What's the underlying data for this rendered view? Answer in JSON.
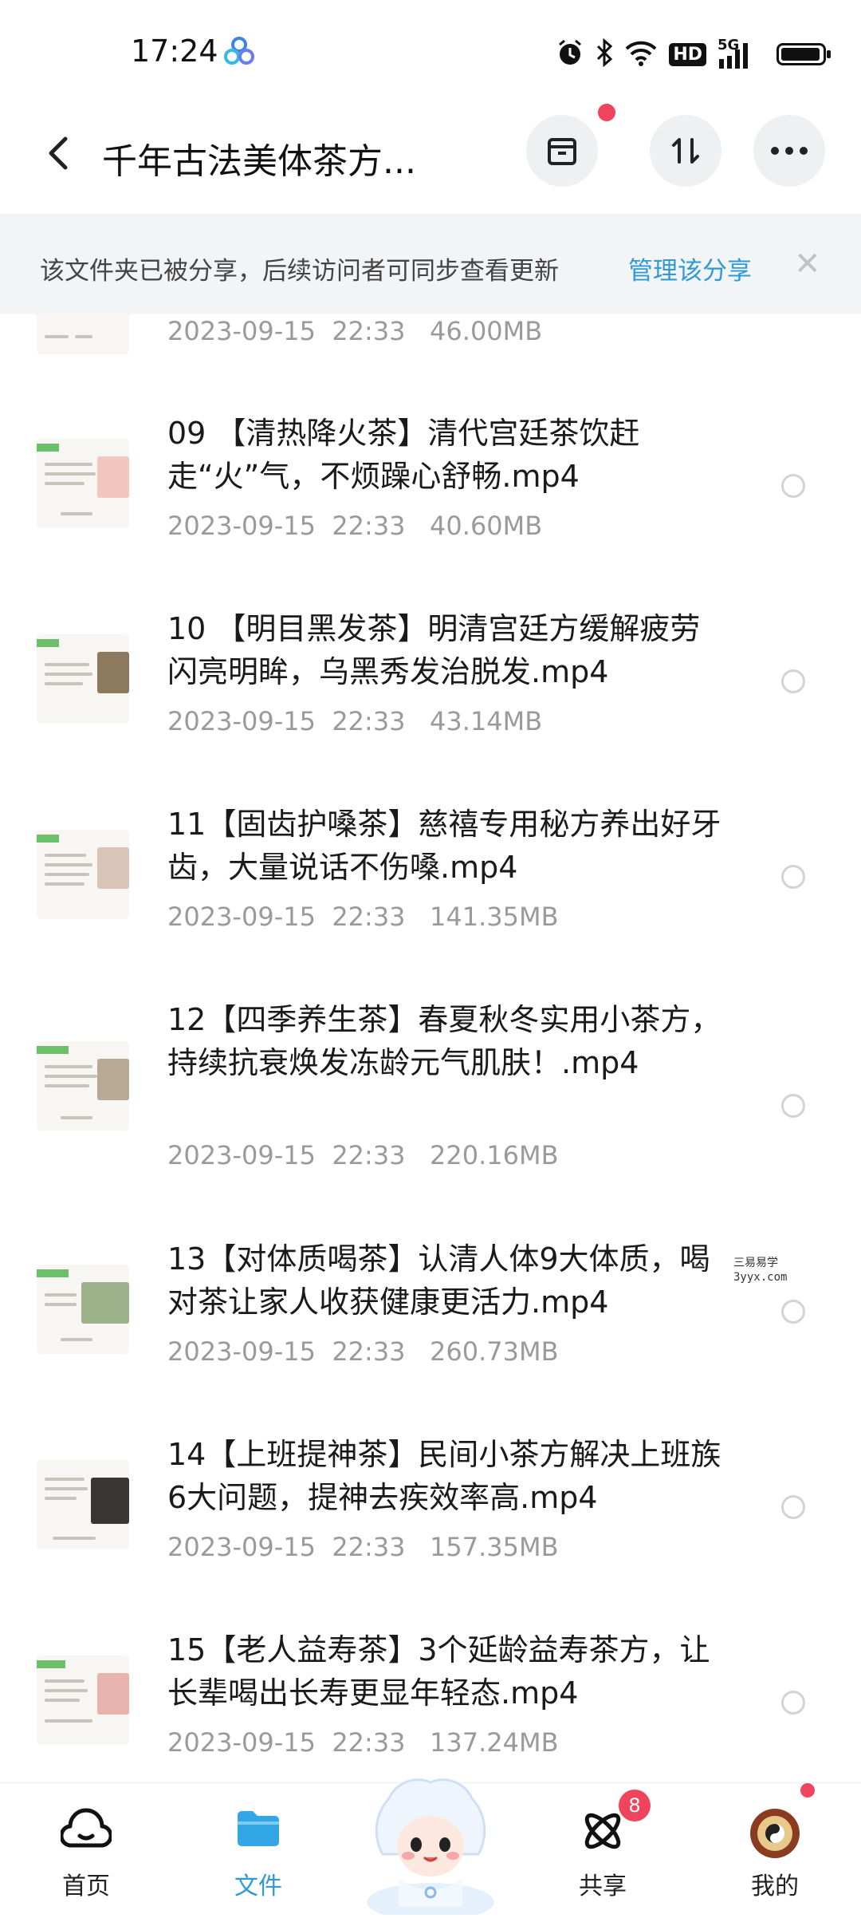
{
  "status_bar": {
    "time": "17:24",
    "icons": [
      "baidu-netdisk-icon",
      "alarm-icon",
      "bluetooth-icon",
      "wifi-icon",
      "hd-icon",
      "5g-signal-icon",
      "battery-icon"
    ],
    "hd_label": "HD",
    "network_label": "5G",
    "battery_level": 0.95
  },
  "header": {
    "title": "千年古法美体茶方...",
    "back_icon": "chevron-left-icon",
    "actions": [
      "archive-icon",
      "sort-icon",
      "more-icon"
    ]
  },
  "share_banner": {
    "text": "该文件夹已被分享，后续访问者可同步查看更新",
    "link": "管理该分享",
    "close": "✕"
  },
  "files": [
    {
      "name": "",
      "meta": "2023-09-15  22:33   46.00MB"
    },
    {
      "name": "09 【清热降火茶】清代宫廷茶饮赶走“火”气，不烦躁心舒畅.mp4",
      "meta": "2023-09-15  22:33   40.60MB"
    },
    {
      "name": "10 【明目黑发茶】明清宫廷方缓解疲劳闪亮明眸，乌黑秀发治脱发.mp4",
      "meta": "2023-09-15  22:33   43.14MB"
    },
    {
      "name": "11【固齿护嗓茶】慈禧专用秘方养出好牙齿，大量说话不伤嗓.mp4",
      "meta": "2023-09-15  22:33   141.35MB"
    },
    {
      "name": "12【四季养生茶】春夏秋冬实用小茶方，持续抗衰焕发冻龄元气肌肤！.mp4",
      "meta": "2023-09-15  22:33   220.16MB"
    },
    {
      "name": "13【对体质喝茶】认清人体9大体质，喝对茶让家人收获健康更活力.mp4",
      "meta": "2023-09-15  22:33   260.73MB"
    },
    {
      "name": "14【上班提神茶】民间小茶方解决上班族6大问题，提神去疾效率高.mp4",
      "meta": "2023-09-15  22:33   157.35MB"
    },
    {
      "name": "15【老人益寿茶】3个延龄益寿茶方，让长辈喝出长寿更显年轻态.mp4",
      "meta": "2023-09-15  22:33   137.24MB"
    }
  ],
  "watermark": {
    "line1": "三易易学",
    "line2": "3yyx.com"
  },
  "bottom_nav": {
    "items": [
      {
        "label": "首页",
        "icon": "cloud-home-icon"
      },
      {
        "label": "文件",
        "icon": "folder-icon",
        "active": true
      },
      {
        "label": "",
        "icon": "mascot-icon"
      },
      {
        "label": "共享",
        "icon": "share-atom-icon",
        "badge": "8"
      },
      {
        "label": "我的",
        "icon": "avatar-icon"
      }
    ],
    "active_color": "#2e9ad6"
  }
}
